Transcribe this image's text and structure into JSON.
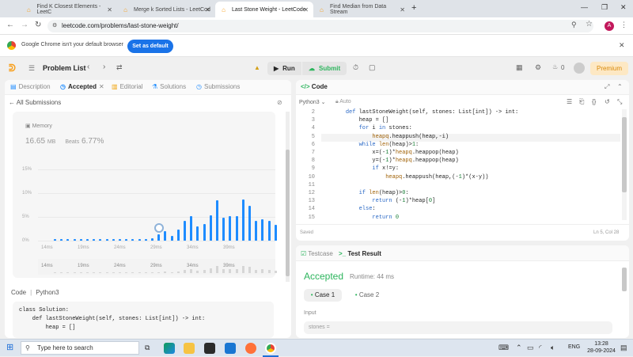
{
  "browser": {
    "tabs": [
      {
        "title": "Find K Closest Elements - LeetC",
        "active": false
      },
      {
        "title": "Merge k Sorted Lists - LeetCod",
        "active": false
      },
      {
        "title": "Last Stone Weight - LeetCode",
        "active": true
      },
      {
        "title": "Find Median from Data Stream",
        "active": false
      }
    ],
    "new_tab": "+",
    "url": "leetcode.com/problems/last-stone-weight/",
    "profile_initial": "A",
    "infobar": {
      "message": "Google Chrome isn't your default browser",
      "button": "Set as default"
    }
  },
  "leetcode": {
    "problem_list": "Problem List",
    "run": "Run",
    "submit": "Submit",
    "streak": "0",
    "premium": "Premium",
    "left_tabs": [
      "Description",
      "Accepted",
      "Editorial",
      "Solutions",
      "Submissions"
    ],
    "all_submissions": "All Submissions",
    "memory_label": "Memory",
    "memory_value": "16.65",
    "memory_unit": "MB",
    "beats_label": "Beats",
    "beats_value": "6.77%",
    "code_label": "Code",
    "code_lang": "Python3",
    "solution_code": [
      "class Solution:",
      "    def lastStoneWeight(self, stones: List[int]) -> int:",
      "        heap = []"
    ],
    "code_panel": {
      "title": "Code",
      "lang": "Python3",
      "mode": "Auto",
      "saved": "Saved",
      "cursor": "Ln 5, Col 28"
    },
    "code_lines": [
      {
        "n": "2",
        "t": "    def lastStoneWeight(self, stones: List[int]) -> int:"
      },
      {
        "n": "3",
        "t": "        heap = []"
      },
      {
        "n": "4",
        "t": "        for i in stones:"
      },
      {
        "n": "5",
        "t": "            heapq.heappush(heap,-i)"
      },
      {
        "n": "6",
        "t": "        while len(heap)>1:"
      },
      {
        "n": "7",
        "t": "            x=(-1)*heapq.heappop(heap)"
      },
      {
        "n": "8",
        "t": "            y=(-1)*heapq.heappop(heap)"
      },
      {
        "n": "9",
        "t": "            if x!=y:"
      },
      {
        "n": "10",
        "t": "                heapq.heappush(heap,(-1)*(x-y))"
      },
      {
        "n": "11",
        "t": ""
      },
      {
        "n": "12",
        "t": "        if len(heap)>0:"
      },
      {
        "n": "13",
        "t": "            return (-1)*heap[0]"
      },
      {
        "n": "14",
        "t": "        else:"
      },
      {
        "n": "15",
        "t": "            return 0"
      }
    ],
    "bottom_tabs": {
      "testcase": "Testcase",
      "result": "Test Result"
    },
    "result": {
      "status": "Accepted",
      "runtime": "Runtime: 44 ms",
      "cases": [
        "Case 1",
        "Case 2"
      ],
      "input_label": "Input",
      "input_var": "stones ="
    }
  },
  "chart_data": {
    "type": "bar",
    "y_ticks": [
      "15%",
      "10%",
      "5%",
      "0%"
    ],
    "x_ticks": [
      "14ms",
      "19ms",
      "24ms",
      "29ms",
      "34ms",
      "39ms"
    ],
    "mini_x_ticks": [
      "14ms",
      "19ms",
      "24ms",
      "29ms",
      "34ms",
      "39ms"
    ],
    "values": [
      0.3,
      0.3,
      0.3,
      0.3,
      0.3,
      0.3,
      0.3,
      0.3,
      0.3,
      0.3,
      0.3,
      0.3,
      0.3,
      0.3,
      0.3,
      0.6,
      1.5,
      2.2,
      1.0,
      2.5,
      4.5,
      5.5,
      3.2,
      3.8,
      5.7,
      9.0,
      5.2,
      5.5,
      5.5,
      9.2,
      7.8,
      4.5,
      4.8,
      4.5,
      3.5
    ],
    "ylim": [
      0,
      16
    ],
    "highlight_index": 16,
    "color": "#1e8cff"
  },
  "taskbar": {
    "search_placeholder": "Type here to search",
    "lang": "ENG",
    "time": "13:28",
    "date": "28-09-2024"
  }
}
